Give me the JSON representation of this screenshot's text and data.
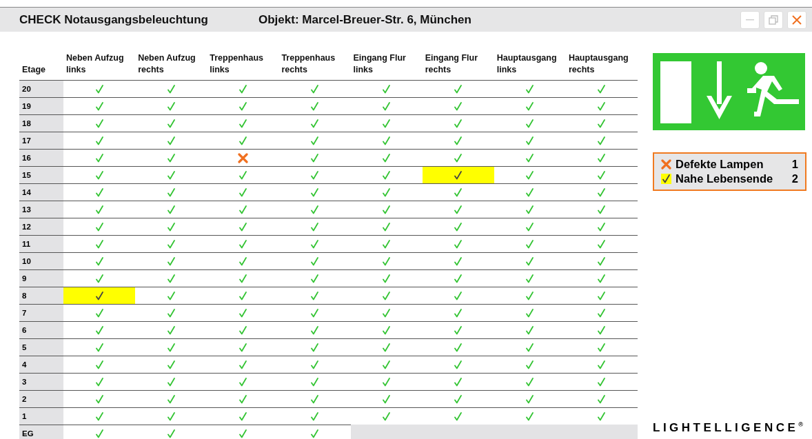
{
  "window": {
    "title": "CHECK Notausgangsbeleuchtung",
    "object": "Objekt: Marcel-Breuer-Str. 6, München"
  },
  "table": {
    "columns": [
      "Etage",
      "Neben Aufzug links",
      "Neben Aufzug rechts",
      "Treppenhaus links",
      "Treppenhaus rechts",
      "Eingang Flur links",
      "Eingang Flur rechts",
      "Hauptausgang links",
      "Hauptausgang rechts"
    ],
    "rows": [
      {
        "floor": "20",
        "cells": [
          {
            "kind": "ok"
          },
          {
            "kind": "ok"
          },
          {
            "kind": "ok"
          },
          {
            "kind": "ok"
          },
          {
            "kind": "ok"
          },
          {
            "kind": "ok"
          },
          {
            "kind": "ok"
          },
          {
            "kind": "ok"
          }
        ]
      },
      {
        "floor": "19",
        "cells": [
          {
            "kind": "ok"
          },
          {
            "kind": "ok"
          },
          {
            "kind": "ok"
          },
          {
            "kind": "ok"
          },
          {
            "kind": "ok"
          },
          {
            "kind": "ok"
          },
          {
            "kind": "ok"
          },
          {
            "kind": "ok"
          }
        ]
      },
      {
        "floor": "18",
        "cells": [
          {
            "kind": "ok"
          },
          {
            "kind": "ok"
          },
          {
            "kind": "ok"
          },
          {
            "kind": "ok"
          },
          {
            "kind": "ok"
          },
          {
            "kind": "ok"
          },
          {
            "kind": "ok"
          },
          {
            "kind": "ok"
          }
        ]
      },
      {
        "floor": "17",
        "cells": [
          {
            "kind": "ok"
          },
          {
            "kind": "ok"
          },
          {
            "kind": "ok"
          },
          {
            "kind": "ok"
          },
          {
            "kind": "ok"
          },
          {
            "kind": "ok"
          },
          {
            "kind": "ok"
          },
          {
            "kind": "ok"
          }
        ]
      },
      {
        "floor": "16",
        "cells": [
          {
            "kind": "ok"
          },
          {
            "kind": "ok"
          },
          {
            "kind": "defect"
          },
          {
            "kind": "ok"
          },
          {
            "kind": "ok"
          },
          {
            "kind": "ok"
          },
          {
            "kind": "ok"
          },
          {
            "kind": "ok"
          }
        ]
      },
      {
        "floor": "15",
        "cells": [
          {
            "kind": "ok"
          },
          {
            "kind": "ok"
          },
          {
            "kind": "ok"
          },
          {
            "kind": "ok"
          },
          {
            "kind": "ok"
          },
          {
            "kind": "eol"
          },
          {
            "kind": "ok"
          },
          {
            "kind": "ok"
          }
        ]
      },
      {
        "floor": "14",
        "cells": [
          {
            "kind": "ok"
          },
          {
            "kind": "ok"
          },
          {
            "kind": "ok"
          },
          {
            "kind": "ok"
          },
          {
            "kind": "ok"
          },
          {
            "kind": "ok"
          },
          {
            "kind": "ok"
          },
          {
            "kind": "ok"
          }
        ]
      },
      {
        "floor": "13",
        "cells": [
          {
            "kind": "ok"
          },
          {
            "kind": "ok"
          },
          {
            "kind": "ok"
          },
          {
            "kind": "ok"
          },
          {
            "kind": "ok"
          },
          {
            "kind": "ok"
          },
          {
            "kind": "ok"
          },
          {
            "kind": "ok"
          }
        ]
      },
      {
        "floor": "12",
        "cells": [
          {
            "kind": "ok"
          },
          {
            "kind": "ok"
          },
          {
            "kind": "ok"
          },
          {
            "kind": "ok"
          },
          {
            "kind": "ok"
          },
          {
            "kind": "ok"
          },
          {
            "kind": "ok"
          },
          {
            "kind": "ok"
          }
        ]
      },
      {
        "floor": "11",
        "cells": [
          {
            "kind": "ok"
          },
          {
            "kind": "ok"
          },
          {
            "kind": "ok"
          },
          {
            "kind": "ok"
          },
          {
            "kind": "ok"
          },
          {
            "kind": "ok"
          },
          {
            "kind": "ok"
          },
          {
            "kind": "ok"
          }
        ]
      },
      {
        "floor": "10",
        "cells": [
          {
            "kind": "ok"
          },
          {
            "kind": "ok"
          },
          {
            "kind": "ok"
          },
          {
            "kind": "ok"
          },
          {
            "kind": "ok"
          },
          {
            "kind": "ok"
          },
          {
            "kind": "ok"
          },
          {
            "kind": "ok"
          }
        ]
      },
      {
        "floor": "9",
        "cells": [
          {
            "kind": "ok"
          },
          {
            "kind": "ok"
          },
          {
            "kind": "ok"
          },
          {
            "kind": "ok"
          },
          {
            "kind": "ok"
          },
          {
            "kind": "ok"
          },
          {
            "kind": "ok"
          },
          {
            "kind": "ok"
          }
        ]
      },
      {
        "floor": "8",
        "cells": [
          {
            "kind": "eol"
          },
          {
            "kind": "ok"
          },
          {
            "kind": "ok"
          },
          {
            "kind": "ok"
          },
          {
            "kind": "ok"
          },
          {
            "kind": "ok"
          },
          {
            "kind": "ok"
          },
          {
            "kind": "ok"
          }
        ]
      },
      {
        "floor": "7",
        "cells": [
          {
            "kind": "ok"
          },
          {
            "kind": "ok"
          },
          {
            "kind": "ok"
          },
          {
            "kind": "ok"
          },
          {
            "kind": "ok"
          },
          {
            "kind": "ok"
          },
          {
            "kind": "ok"
          },
          {
            "kind": "ok"
          }
        ]
      },
      {
        "floor": "6",
        "cells": [
          {
            "kind": "ok"
          },
          {
            "kind": "ok"
          },
          {
            "kind": "ok"
          },
          {
            "kind": "ok"
          },
          {
            "kind": "ok"
          },
          {
            "kind": "ok"
          },
          {
            "kind": "ok"
          },
          {
            "kind": "ok"
          }
        ]
      },
      {
        "floor": "5",
        "cells": [
          {
            "kind": "ok"
          },
          {
            "kind": "ok"
          },
          {
            "kind": "ok"
          },
          {
            "kind": "ok"
          },
          {
            "kind": "ok"
          },
          {
            "kind": "ok"
          },
          {
            "kind": "ok"
          },
          {
            "kind": "ok"
          }
        ]
      },
      {
        "floor": "4",
        "cells": [
          {
            "kind": "ok"
          },
          {
            "kind": "ok"
          },
          {
            "kind": "ok"
          },
          {
            "kind": "ok"
          },
          {
            "kind": "ok"
          },
          {
            "kind": "ok"
          },
          {
            "kind": "ok"
          },
          {
            "kind": "ok"
          }
        ]
      },
      {
        "floor": "3",
        "cells": [
          {
            "kind": "ok"
          },
          {
            "kind": "ok"
          },
          {
            "kind": "ok"
          },
          {
            "kind": "ok"
          },
          {
            "kind": "ok"
          },
          {
            "kind": "ok"
          },
          {
            "kind": "ok"
          },
          {
            "kind": "ok"
          }
        ]
      },
      {
        "floor": "2",
        "cells": [
          {
            "kind": "ok"
          },
          {
            "kind": "ok"
          },
          {
            "kind": "ok"
          },
          {
            "kind": "ok"
          },
          {
            "kind": "ok"
          },
          {
            "kind": "ok"
          },
          {
            "kind": "ok"
          },
          {
            "kind": "ok"
          }
        ]
      },
      {
        "floor": "1",
        "cells": [
          {
            "kind": "ok"
          },
          {
            "kind": "ok"
          },
          {
            "kind": "ok"
          },
          {
            "kind": "ok"
          },
          {
            "kind": "ok"
          },
          {
            "kind": "ok"
          },
          {
            "kind": "ok"
          },
          {
            "kind": "ok"
          }
        ]
      },
      {
        "floor": "EG",
        "cells": [
          {
            "kind": "ok"
          },
          {
            "kind": "ok"
          },
          {
            "kind": "ok"
          },
          {
            "kind": "ok"
          },
          {
            "kind": "none"
          },
          {
            "kind": "none"
          },
          {
            "kind": "none"
          },
          {
            "kind": "none"
          }
        ]
      }
    ]
  },
  "legend": [
    {
      "kind": "defect",
      "label": "Defekte Lampen",
      "count": "1"
    },
    {
      "kind": "eol",
      "label": "Nahe Lebensende",
      "count": "2"
    }
  ],
  "logo": "LIGHTELLIGENCE$^{®}$"
}
